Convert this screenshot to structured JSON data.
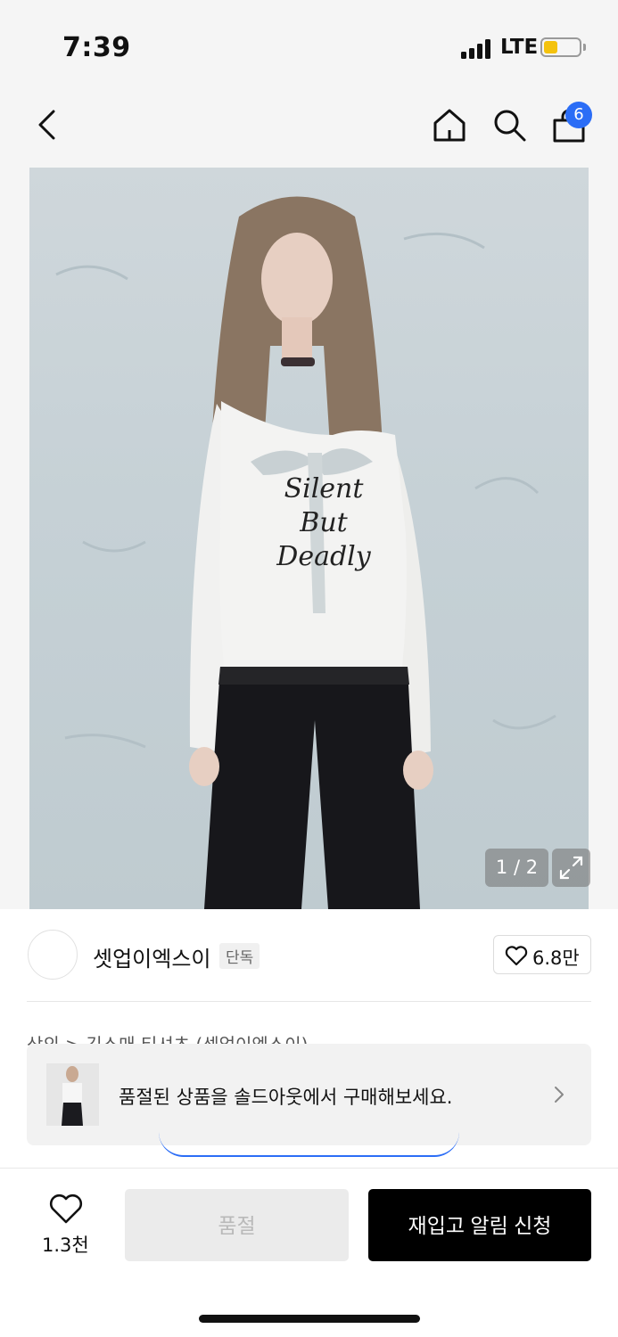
{
  "status_bar": {
    "time": "7:39",
    "network": "LTE"
  },
  "nav": {
    "cart_count": "6",
    "icons": [
      "back-icon",
      "home-icon",
      "search-icon",
      "shopping-bag-icon"
    ]
  },
  "gallery": {
    "pager": "1 / 2",
    "shirt_text": [
      "Silent",
      "But",
      "Deadly"
    ]
  },
  "brand": {
    "name": "셋업이엑스이",
    "badge": "단독",
    "likes": "6.8만"
  },
  "breadcrumb": "상의 > 긴소매 티셔츠 (셋업이엑스이)",
  "soldout_banner": {
    "text": "품절된 상품을 솔드아웃에서 구매해보세요."
  },
  "bottom_bar": {
    "wish_count": "1.3천",
    "soldout_label": "품절",
    "restock_label": "재입고 알림 신청"
  },
  "colors": {
    "accent_blue": "#2b6df6",
    "battery": "#f4c20d",
    "primary_button": "#000000"
  }
}
